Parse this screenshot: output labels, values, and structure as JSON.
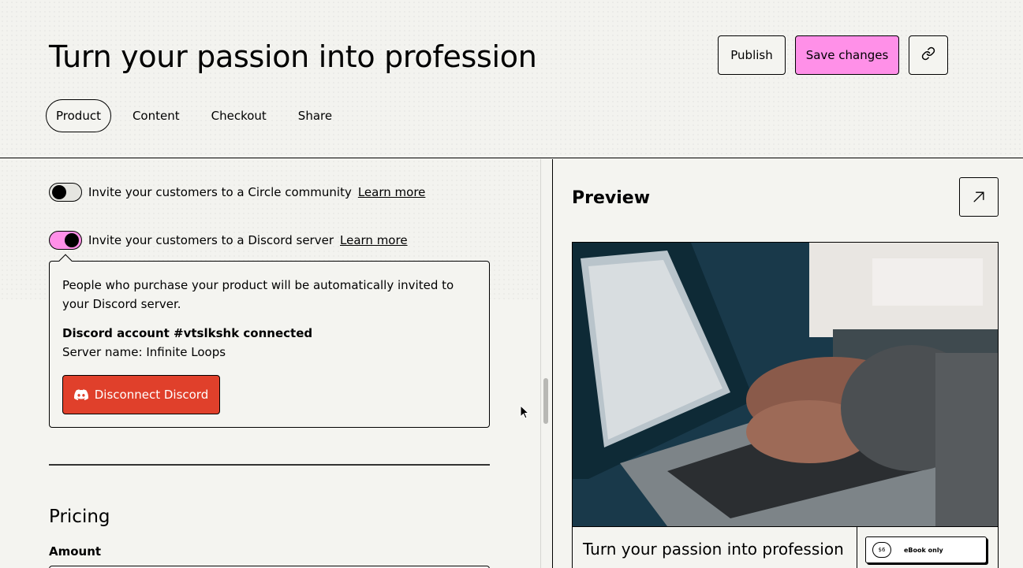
{
  "header": {
    "title": "Turn your passion into profession",
    "publish_label": "Publish",
    "save_label": "Save changes",
    "tabs": [
      {
        "label": "Product",
        "active": true
      },
      {
        "label": "Content",
        "active": false
      },
      {
        "label": "Checkout",
        "active": false
      },
      {
        "label": "Share",
        "active": false
      }
    ]
  },
  "integrations": {
    "circle": {
      "label": "Invite your customers to a Circle community",
      "link": "Learn more",
      "enabled": false
    },
    "discord": {
      "label": "Invite your customers to a Discord server",
      "link": "Learn more",
      "enabled": true,
      "description": "People who purchase your product will be automatically invited to your Discord server.",
      "account": "Discord account #vtslkshk connected",
      "server": "Server name: Infinite Loops",
      "disconnect_label": "Disconnect Discord"
    }
  },
  "pricing": {
    "heading": "Pricing",
    "amount_label": "Amount"
  },
  "preview": {
    "title": "Preview",
    "card_title": "Turn your passion into profession",
    "price": "$6",
    "format": "eBook only"
  },
  "colors": {
    "accent_pink": "#ff90e8",
    "danger_red": "#e0402b",
    "background": "#f4f4f0"
  },
  "icons": {
    "link": "link-icon",
    "open": "arrow-up-right-icon",
    "discord": "discord-icon"
  }
}
